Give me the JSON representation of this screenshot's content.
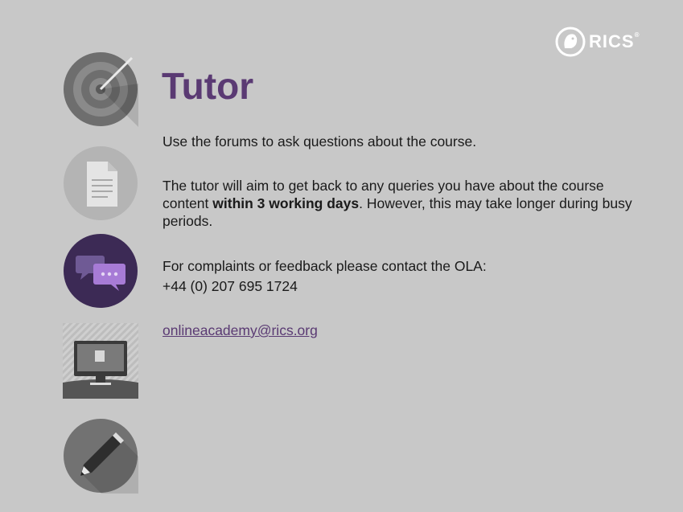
{
  "logo": {
    "text": "RICS",
    "reg": "®"
  },
  "title": "Tutor",
  "intro": "Use the forums to ask questions about the course.",
  "tutor_info": {
    "before": "The tutor will aim to get back to any queries you have about the course content ",
    "bold": "within 3 working days",
    "after": ". However, this may take longer during busy periods."
  },
  "contact": {
    "label": "For complaints or feedback please contact the OLA:",
    "phone": "+44 (0) 207 695 1724",
    "email": "onlineacademy@rics.org"
  },
  "icons": [
    "target-icon",
    "document-icon",
    "chat-bubbles-icon",
    "monitor-icon",
    "pencil-icon"
  ],
  "colors": {
    "background": "#c8c8c8",
    "accent_purple": "#5a3a73",
    "text": "#1a1a1a"
  }
}
